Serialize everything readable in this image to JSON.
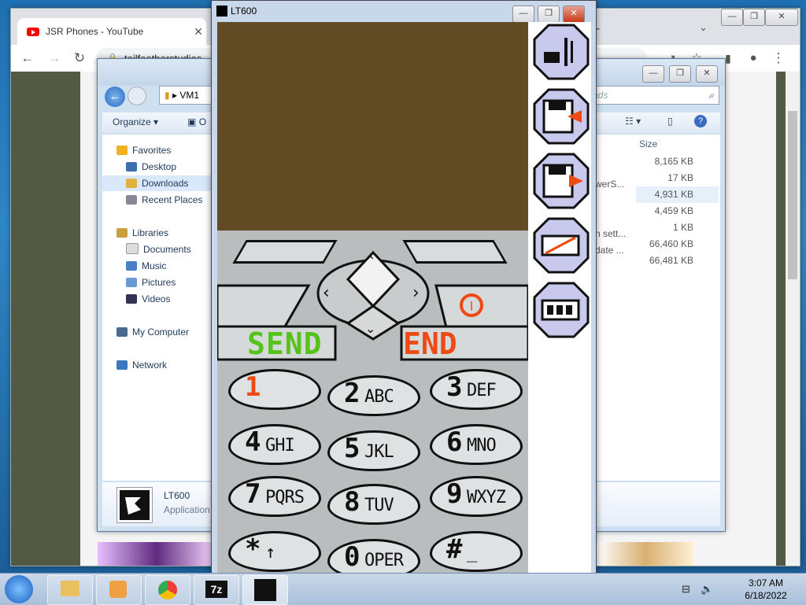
{
  "chrome": {
    "tab_title": "JSR Phones - YouTube",
    "url": "tailfeatherstudios"
  },
  "explorer": {
    "address": "VM1",
    "search_placeholder": "ads",
    "organize": "Organize",
    "open_fragment": "O",
    "nav": {
      "favorites": "Favorites",
      "desktop": "Desktop",
      "downloads": "Downloads",
      "recent": "Recent Places",
      "libraries": "Libraries",
      "documents": "Documents",
      "music": "Music",
      "pictures": "Pictures",
      "videos": "Videos",
      "mycomputer": "My Computer",
      "network": "Network"
    },
    "size_header": "Size",
    "name_fragments": [
      "werS...",
      "n sett...",
      "date ..."
    ],
    "sizes": [
      "8,165 KB",
      "17 KB",
      "4,931 KB",
      "4,459 KB",
      "1 KB",
      "66,460 KB",
      "66,481 KB"
    ],
    "details_name": "LT600",
    "details_type": "Application"
  },
  "emulator": {
    "title": "LT600",
    "send": "SEND",
    "end": "END",
    "keys": [
      {
        "num": "1",
        "sub": ""
      },
      {
        "num": "2",
        "sub": "ABC"
      },
      {
        "num": "3",
        "sub": "DEF"
      },
      {
        "num": "4",
        "sub": "GHI"
      },
      {
        "num": "5",
        "sub": "JKL"
      },
      {
        "num": "6",
        "sub": "MNO"
      },
      {
        "num": "7",
        "sub": "PQRS"
      },
      {
        "num": "8",
        "sub": "TUV"
      },
      {
        "num": "9",
        "sub": "WXYZ"
      },
      {
        "num": "*",
        "sub": "↑"
      },
      {
        "num": "0",
        "sub": "OPER"
      },
      {
        "num": "#",
        "sub": "_"
      }
    ]
  },
  "taskbar": {
    "time": "3:07 AM",
    "date": "6/18/2022",
    "app_7z": "7z"
  }
}
